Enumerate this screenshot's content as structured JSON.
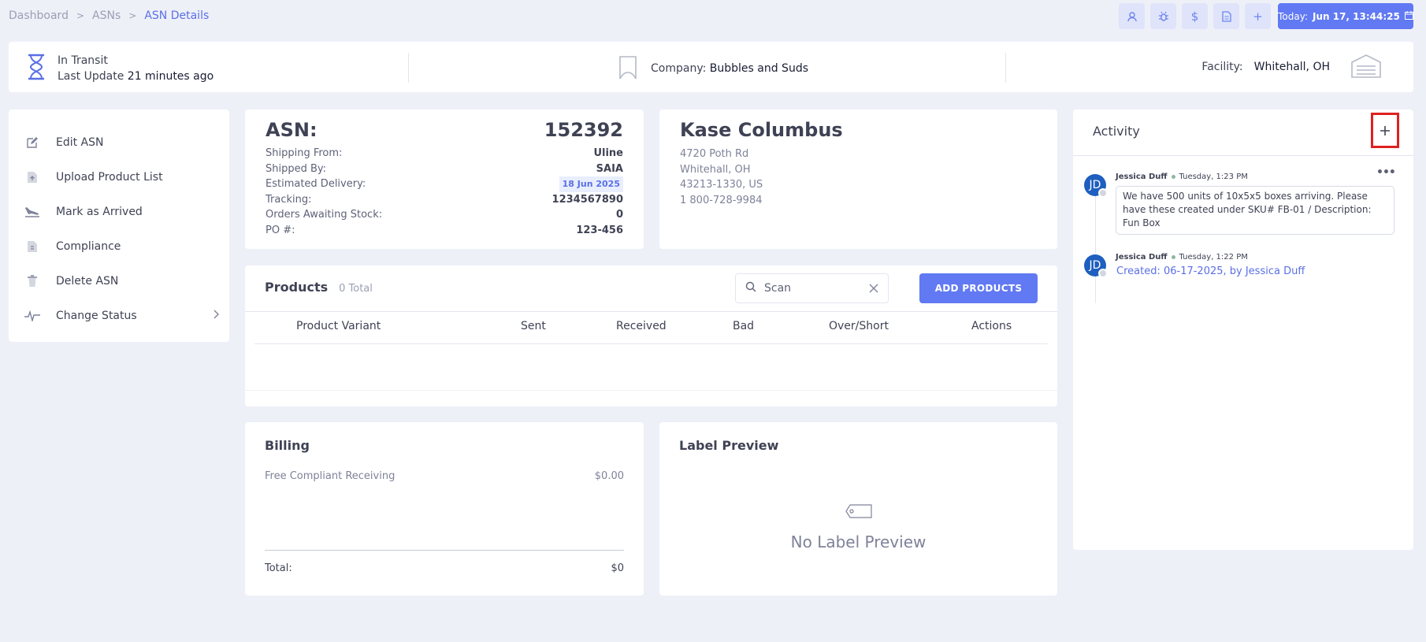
{
  "breadcrumb": {
    "items": [
      "Dashboard",
      "ASNs"
    ],
    "current": "ASN Details",
    "separator": ">"
  },
  "toolbar": {
    "icons": [
      "user-icon",
      "bug-icon",
      "dollar-icon",
      "document-icon",
      "plus-icon"
    ],
    "today_prefix": "Today:",
    "today_value": "Jun 17, 13:44:25"
  },
  "status": {
    "state": "In Transit",
    "last_update_label": "Last Update",
    "last_update_value": "21 minutes ago",
    "company_label": "Company:",
    "company_value": "Bubbles and Suds",
    "facility_label": "Facility:",
    "facility_value": "Whitehall, OH"
  },
  "menu": {
    "items": [
      {
        "label": "Edit ASN",
        "icon": "edit-icon"
      },
      {
        "label": "Upload Product List",
        "icon": "upload-file-icon"
      },
      {
        "label": "Mark as Arrived",
        "icon": "plane-landing-icon"
      },
      {
        "label": "Compliance",
        "icon": "compliance-file-icon"
      },
      {
        "label": "Delete ASN",
        "icon": "trash-icon"
      },
      {
        "label": "Change Status",
        "icon": "pulse-icon"
      }
    ]
  },
  "asn": {
    "label": "ASN:",
    "number": "152392",
    "rows": [
      {
        "k": "Shipping From:",
        "v": "Uline"
      },
      {
        "k": "Shipped By:",
        "v": "SAIA"
      },
      {
        "k": "Estimated Delivery:",
        "v": "18 Jun 2025"
      },
      {
        "k": "Tracking:",
        "v": "1234567890"
      },
      {
        "k": "Orders Awaiting Stock:",
        "v": "0"
      },
      {
        "k": "PO #:",
        "v": "123-456"
      }
    ]
  },
  "address": {
    "name": "Kase Columbus",
    "lines": [
      "4720 Poth Rd",
      "Whitehall, OH",
      "43213-1330, US",
      "1 800-728-9984"
    ]
  },
  "products": {
    "title": "Products",
    "count": "0 Total",
    "scan_value": "Scan",
    "add_button": "ADD PRODUCTS",
    "columns": [
      "Product Variant",
      "Sent",
      "Received",
      "Bad",
      "Over/Short",
      "Actions"
    ]
  },
  "billing": {
    "title": "Billing",
    "line_label": "Free Compliant Receiving",
    "line_value": "$0.00",
    "total_label": "Total:",
    "total_value": "$0"
  },
  "label_preview": {
    "title": "Label Preview",
    "empty_text": "No Label Preview"
  },
  "activity": {
    "title": "Activity",
    "entries": [
      {
        "initials": "JD",
        "author": "Jessica Duff",
        "time": "Tuesday, 1:23 PM",
        "text": "We have 500 units of 10x5x5 boxes arriving. Please have these created under SKU# FB-01 / Description: Fun Box"
      },
      {
        "initials": "JD",
        "author": "Jessica Duff",
        "time": "Tuesday, 1:22 PM",
        "text": "Created: 06-17-2025, by Jessica Duff"
      }
    ]
  },
  "colors": {
    "accent": "#6179f2",
    "highlight_box": "#e02020",
    "avatar": "#1e5fbf"
  }
}
